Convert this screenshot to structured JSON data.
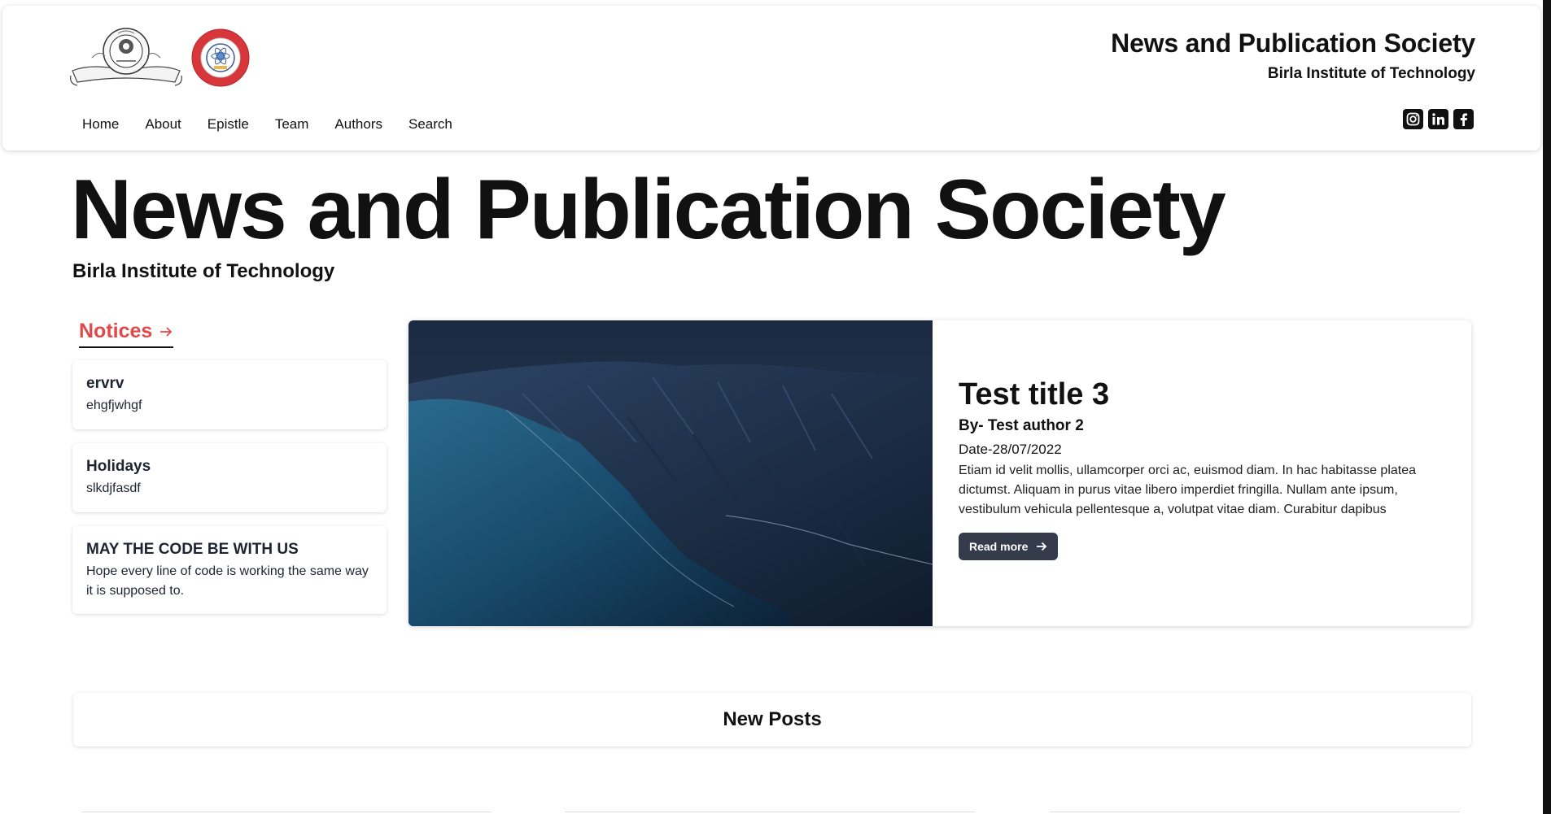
{
  "header": {
    "title": "News and Publication Society",
    "subtitle": "Birla Institute of Technology",
    "nav": [
      "Home",
      "About",
      "Epistle",
      "Team",
      "Authors",
      "Search"
    ],
    "social": [
      {
        "icon": "instagram-icon",
        "glyph": "◎"
      },
      {
        "icon": "linkedin-icon",
        "glyph": "in"
      },
      {
        "icon": "facebook-icon",
        "glyph": "f"
      }
    ]
  },
  "hero": {
    "title": "News and Publication Society",
    "subtitle": "Birla Institute of Technology"
  },
  "notices": {
    "heading": "Notices",
    "items": [
      {
        "title": "ervrv",
        "body": "ehgfjwhgf"
      },
      {
        "title": "Holidays",
        "body": "slkdjfasdf"
      },
      {
        "title": "MAY THE CODE BE WITH US",
        "body": "Hope every line of code is working the same way it is supposed to."
      }
    ]
  },
  "featured": {
    "title": "Test title 3",
    "author": "By- Test author 2",
    "date": "Date-28/07/2022",
    "excerpt": "Etiam id velit mollis, ullamcorper orci ac, euismod diam. In hac habitasse platea dictumst. Aliquam in purus vitae libero imperdiet fringilla. Nullam ante ipsum, vestibulum vehicula pellentesque a, volutpat vitae diam. Curabitur dapibus",
    "read_more": "Read more"
  },
  "new_posts": {
    "label": "New Posts"
  },
  "colors": {
    "accent": "#e2484a",
    "button": "#343c4b"
  }
}
